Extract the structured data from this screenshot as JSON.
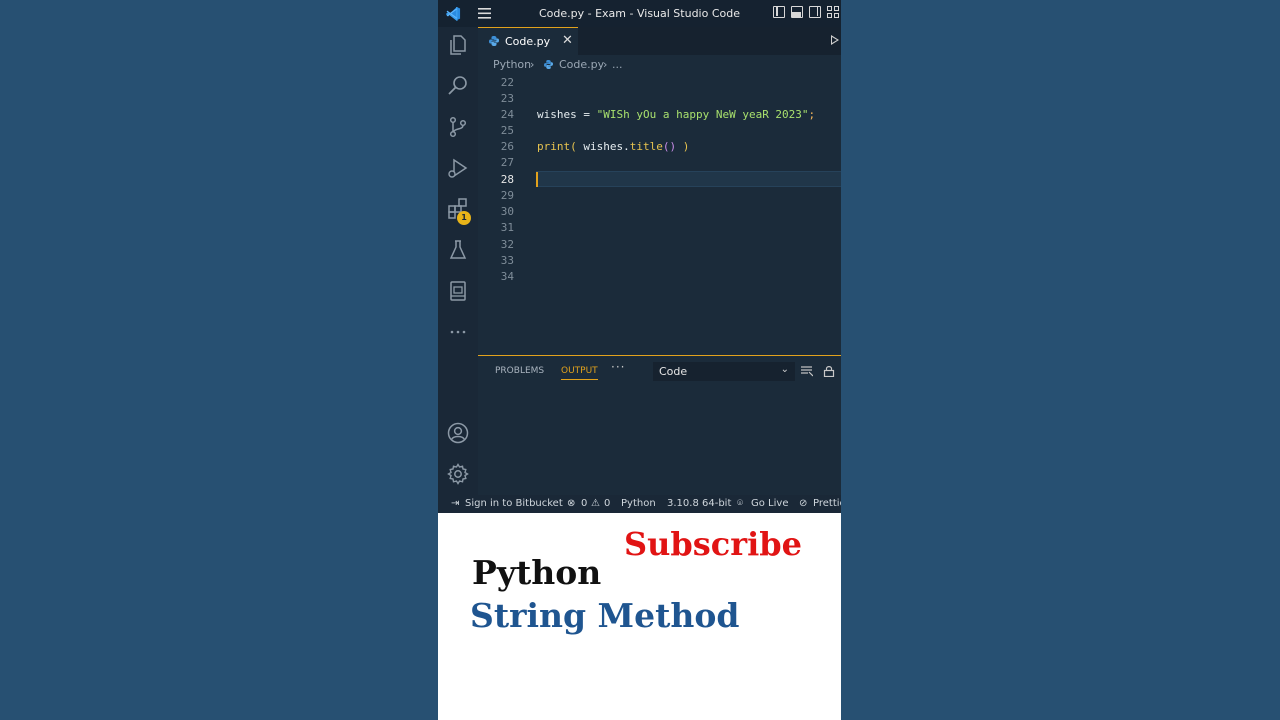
{
  "window": {
    "title": "Code.py - Exam - Visual Studio Code"
  },
  "activity_bar": {
    "extensions_badge": "1"
  },
  "editor": {
    "tab_label": "Code.py",
    "breadcrumb": [
      "Python",
      "Code.py",
      "..."
    ],
    "line_numbers": [
      "22",
      "23",
      "24",
      "25",
      "26",
      "27",
      "28",
      "29",
      "30",
      "31",
      "32",
      "33",
      "34"
    ],
    "active_line": "28",
    "lines": {
      "l24": {
        "var": "wishes",
        "op": " = ",
        "str": "\"WISh yOu a happy NeW yeaR 2023\"",
        "punc": ";"
      },
      "l26": {
        "fn": "print",
        "open": "(",
        "arg": " wishes.",
        "method": "title",
        "call": "()",
        "close": " )"
      }
    }
  },
  "panel": {
    "tabs": [
      "PROBLEMS",
      "OUTPUT"
    ],
    "active_tab": "OUTPUT",
    "more": "···",
    "output_channel": "Code"
  },
  "status_bar": {
    "bitbucket": "Sign in to Bitbucket",
    "errors": "0",
    "warnings": "0",
    "language": "Python",
    "interpreter": "3.10.8 64-bit",
    "go_live": "Go Live",
    "prettier": "Prettier"
  },
  "overlay": {
    "subscribe": "Subscribe",
    "line1": "Python",
    "line2": "String Method"
  },
  "colors": {
    "page_background": "#275072",
    "accent": "#e2a21c",
    "subscribe": "#e11414",
    "method_text": "#1f5590"
  }
}
